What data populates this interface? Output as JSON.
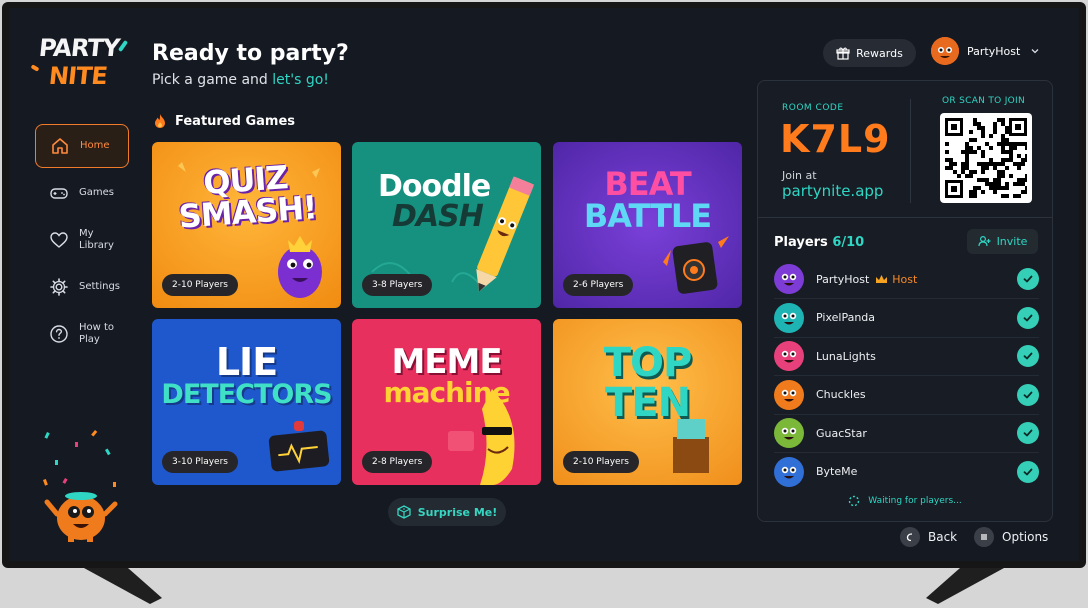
{
  "logo": {
    "line1": "PARTY",
    "line2": "NITE"
  },
  "nav": [
    {
      "label": "Home",
      "icon": "home-icon",
      "active": true
    },
    {
      "label": "Games",
      "icon": "gamepad-icon",
      "active": false
    },
    {
      "label": "My Library",
      "icon": "heart-icon",
      "active": false
    },
    {
      "label": "Settings",
      "icon": "gear-icon",
      "active": false
    },
    {
      "label": "How to Play",
      "icon": "help-icon",
      "active": false
    }
  ],
  "header": {
    "title": "Ready to party?",
    "subtitle_prefix": "Pick a game and ",
    "subtitle_accent": "let's go!"
  },
  "featured": {
    "label": "Featured Games",
    "icon": "fire-icon"
  },
  "games": [
    {
      "title_line1": "QUIZ",
      "title_line2": "SMASH!",
      "players": "2-10 Players",
      "bg": "#f59b1c"
    },
    {
      "title_line1": "Doodle",
      "title_line2": "DASH",
      "players": "3-8 Players",
      "bg": "#16907f"
    },
    {
      "title_line1": "BEAT",
      "title_line2": "BATTLE",
      "players": "2-6 Players",
      "bg": "#5a2fb5"
    },
    {
      "title_line1": "LIE",
      "title_line2": "DETECTORS",
      "players": "3-10 Players",
      "bg": "#1f58cc"
    },
    {
      "title_line1": "MEME",
      "title_line2": "machine",
      "players": "2-8 Players",
      "bg": "#e8305f"
    },
    {
      "title_line1": "TOP",
      "title_line2": "TEN",
      "players": "2-10 Players",
      "bg": "#f5a321"
    }
  ],
  "surprise": {
    "label": "Surprise Me!",
    "icon": "dice-icon"
  },
  "rewards": {
    "label": "Rewards",
    "icon": "gift-icon"
  },
  "profile": {
    "name": "PartyHost"
  },
  "room": {
    "code_label": "ROOM CODE",
    "code": "K7L9",
    "join_at": "Join at",
    "url": "partynite.app",
    "scan_label": "OR SCAN TO JOIN"
  },
  "players": {
    "title": "Players",
    "count": "6/10",
    "invite_label": "Invite",
    "list": [
      {
        "name": "PartyHost",
        "host_label": "Host",
        "avatar_color": "#7d3cd6"
      },
      {
        "name": "PixelPanda",
        "avatar_color": "#1fb4b4"
      },
      {
        "name": "LunaLights",
        "avatar_color": "#e8407a"
      },
      {
        "name": "Chuckles",
        "avatar_color": "#f07b1c"
      },
      {
        "name": "GuacStar",
        "avatar_color": "#7bb83a"
      },
      {
        "name": "ByteMe",
        "avatar_color": "#2f6fd6"
      }
    ],
    "waiting": "Waiting for players..."
  },
  "hints": {
    "back": "Back",
    "options": "Options"
  },
  "colors": {
    "accent_teal": "#2fd6c4",
    "accent_orange": "#ff7b1c",
    "background": "#151922"
  }
}
